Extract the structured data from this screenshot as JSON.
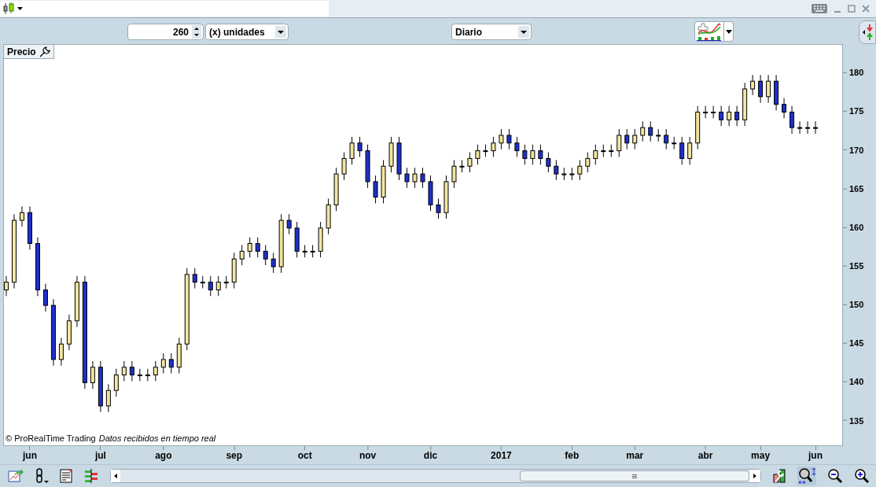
{
  "toolbar": {
    "bar_count": "260",
    "unit": "(x) unidades",
    "period": "Diario"
  },
  "chart": {
    "copyright": "© ProRealTime Trading",
    "status": "Datos recibidos en tiempo real",
    "chart_data": {
      "type": "candlestick",
      "title": "Precio",
      "ylim": [
        131.9,
        183.7
      ],
      "yticks": [
        135,
        140,
        145,
        150,
        155,
        160,
        165,
        170,
        175,
        180
      ],
      "categories": [
        null,
        null,
        null,
        "jun",
        null,
        null,
        null,
        null,
        null,
        null,
        null,
        null,
        "jul",
        null,
        null,
        null,
        null,
        null,
        null,
        null,
        "ago",
        null,
        null,
        null,
        null,
        null,
        null,
        null,
        null,
        "sep",
        null,
        null,
        null,
        null,
        null,
        null,
        null,
        null,
        "oct",
        null,
        null,
        null,
        null,
        null,
        null,
        null,
        "nov",
        null,
        null,
        null,
        null,
        null,
        null,
        null,
        "dic",
        null,
        null,
        null,
        null,
        null,
        null,
        null,
        null,
        "2017",
        null,
        null,
        null,
        null,
        null,
        null,
        null,
        null,
        "feb",
        null,
        null,
        null,
        null,
        null,
        null,
        null,
        "mar",
        null,
        null,
        null,
        null,
        null,
        null,
        null,
        null,
        "abr",
        null,
        null,
        null,
        null,
        null,
        null,
        "may",
        null,
        null,
        null,
        null,
        null,
        null,
        "jun"
      ],
      "ohlc": [
        [
          152,
          153.8,
          151.2,
          153
        ],
        [
          153,
          161.8,
          152.2,
          161
        ],
        [
          161,
          162.8,
          160.2,
          162
        ],
        [
          162,
          162.8,
          157.2,
          158
        ],
        [
          158,
          158.8,
          151.2,
          152
        ],
        [
          152,
          152.8,
          149.2,
          150
        ],
        [
          150,
          150.8,
          142.2,
          143
        ],
        [
          143,
          145.8,
          142.2,
          145
        ],
        [
          145,
          148.8,
          144.2,
          148
        ],
        [
          148,
          153.8,
          147.2,
          153
        ],
        [
          153,
          153.8,
          139.2,
          140
        ],
        [
          140,
          142.8,
          139.2,
          142
        ],
        [
          142,
          142.8,
          136.2,
          137
        ],
        [
          137,
          139.8,
          136.2,
          139
        ],
        [
          139,
          141.8,
          138.2,
          141
        ],
        [
          141,
          142.8,
          140.2,
          142
        ],
        [
          142,
          142.8,
          140.2,
          141
        ],
        [
          141,
          141.8,
          140.2,
          141
        ],
        [
          141,
          141.8,
          140.2,
          141
        ],
        [
          141,
          142.8,
          140.2,
          142
        ],
        [
          142,
          143.8,
          141.2,
          143
        ],
        [
          143,
          143.8,
          141.2,
          142
        ],
        [
          142,
          145.8,
          141.2,
          145
        ],
        [
          145,
          154.8,
          144.2,
          154
        ],
        [
          154,
          154.8,
          152.2,
          153
        ],
        [
          153,
          153.8,
          152.2,
          153
        ],
        [
          153,
          153.8,
          151.2,
          152
        ],
        [
          152,
          153.8,
          151.2,
          153
        ],
        [
          153,
          153.8,
          152.2,
          153
        ],
        [
          153,
          156.8,
          152.2,
          156
        ],
        [
          156,
          157.8,
          155.2,
          157
        ],
        [
          157,
          158.8,
          156.2,
          158
        ],
        [
          158,
          158.8,
          156.2,
          157
        ],
        [
          157,
          157.8,
          155.2,
          156
        ],
        [
          156,
          156.8,
          154.2,
          155
        ],
        [
          155,
          161.8,
          154.2,
          161
        ],
        [
          161,
          161.8,
          159.2,
          160
        ],
        [
          160,
          160.8,
          156.2,
          157
        ],
        [
          157,
          157.8,
          156.2,
          157
        ],
        [
          157,
          157.8,
          156.2,
          157
        ],
        [
          157,
          160.8,
          156.2,
          160
        ],
        [
          160,
          163.8,
          159.2,
          163
        ],
        [
          163,
          167.8,
          162.2,
          167
        ],
        [
          167,
          169.8,
          166.2,
          169
        ],
        [
          169,
          171.8,
          168.2,
          171
        ],
        [
          171,
          171.8,
          169.2,
          170
        ],
        [
          170,
          170.8,
          165.2,
          166
        ],
        [
          166,
          166.8,
          163.2,
          164
        ],
        [
          164,
          168.8,
          163.2,
          168
        ],
        [
          168,
          171.8,
          167.2,
          171
        ],
        [
          171,
          171.8,
          166.2,
          167
        ],
        [
          167,
          167.8,
          165.2,
          166
        ],
        [
          166,
          167.8,
          165.2,
          167
        ],
        [
          167,
          167.8,
          165.2,
          166
        ],
        [
          166,
          166.8,
          162.2,
          163
        ],
        [
          163,
          163.8,
          161.2,
          162
        ],
        [
          162,
          166.8,
          161.2,
          166
        ],
        [
          166,
          168.8,
          165.2,
          168
        ],
        [
          168,
          168.8,
          167.2,
          168
        ],
        [
          168,
          169.8,
          167.2,
          169
        ],
        [
          169,
          170.8,
          168.2,
          170
        ],
        [
          170,
          170.8,
          169.2,
          170
        ],
        [
          170,
          171.8,
          169.2,
          171
        ],
        [
          171,
          172.8,
          170.2,
          172
        ],
        [
          172,
          172.8,
          170.2,
          171
        ],
        [
          171,
          171.8,
          169.2,
          170
        ],
        [
          170,
          170.8,
          168.2,
          169
        ],
        [
          169,
          170.8,
          168.2,
          170
        ],
        [
          170,
          170.8,
          168.2,
          169
        ],
        [
          169,
          169.8,
          167.2,
          168
        ],
        [
          168,
          168.8,
          166.2,
          167
        ],
        [
          167,
          167.8,
          166.2,
          167
        ],
        [
          167,
          167.8,
          166.2,
          167
        ],
        [
          167,
          168.8,
          166.2,
          168
        ],
        [
          168,
          169.8,
          167.2,
          169
        ],
        [
          169,
          170.8,
          168.2,
          170
        ],
        [
          170,
          170.8,
          169.2,
          170
        ],
        [
          170,
          170.8,
          169.2,
          170
        ],
        [
          170,
          172.8,
          169.2,
          172
        ],
        [
          172,
          172.8,
          170.2,
          171
        ],
        [
          171,
          172.8,
          170.2,
          172
        ],
        [
          172,
          173.8,
          171.2,
          173
        ],
        [
          173,
          173.8,
          171.2,
          172
        ],
        [
          172,
          172.8,
          171.2,
          172
        ],
        [
          172,
          172.8,
          170.2,
          171
        ],
        [
          171,
          171.8,
          170.2,
          171
        ],
        [
          171,
          171.8,
          168.2,
          169
        ],
        [
          169,
          171.8,
          168.2,
          171
        ],
        [
          171,
          175.8,
          170.2,
          175
        ],
        [
          175,
          175.8,
          174.2,
          175
        ],
        [
          175,
          175.8,
          174.2,
          175
        ],
        [
          175,
          175.8,
          173.2,
          174
        ],
        [
          174,
          175.8,
          173.2,
          175
        ],
        [
          175,
          175.8,
          173.2,
          174
        ],
        [
          174,
          178.8,
          173.2,
          178
        ],
        [
          178,
          179.8,
          177.2,
          179
        ],
        [
          179,
          179.8,
          176.2,
          177
        ],
        [
          177,
          179.8,
          176.2,
          179
        ],
        [
          179,
          179.8,
          175.2,
          176
        ],
        [
          176,
          176.8,
          174.2,
          175
        ],
        [
          175,
          175.8,
          172.2,
          173
        ],
        [
          173,
          173.8,
          172.2,
          173
        ],
        [
          173,
          173.8,
          172.2,
          173
        ],
        [
          173,
          173.8,
          172.2,
          173
        ]
      ]
    }
  }
}
